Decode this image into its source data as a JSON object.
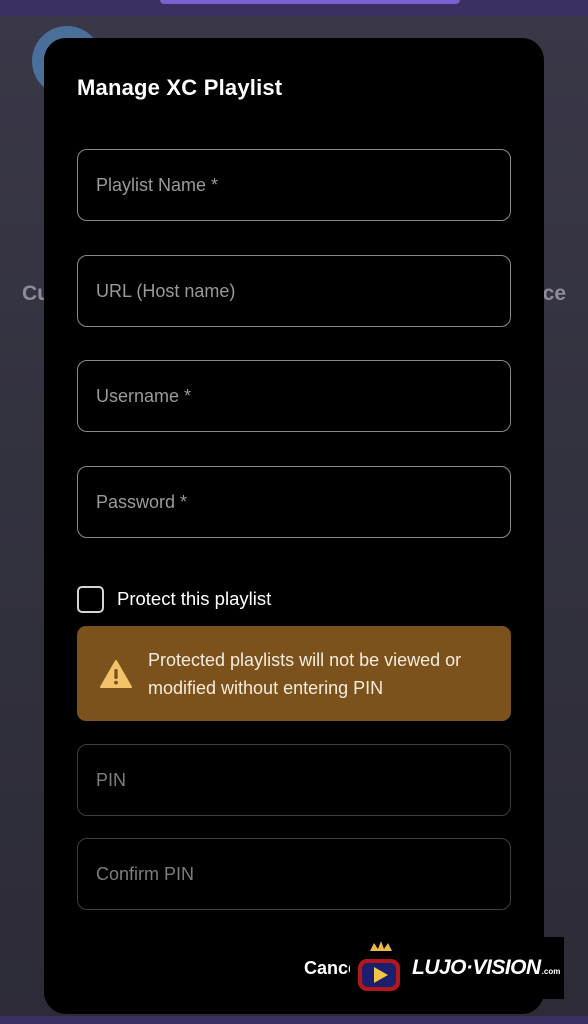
{
  "background": {
    "left_text": "Cu",
    "right_text": "ce"
  },
  "modal": {
    "title": "Manage XC Playlist",
    "fields": {
      "playlist_name": {
        "placeholder": "Playlist Name *",
        "value": ""
      },
      "url": {
        "placeholder": "URL (Host name)",
        "value": ""
      },
      "username": {
        "placeholder": "Username *",
        "value": ""
      },
      "password": {
        "placeholder": "Password *",
        "value": ""
      },
      "pin": {
        "placeholder": "PIN",
        "value": ""
      },
      "confirm_pin": {
        "placeholder": "Confirm PIN",
        "value": ""
      }
    },
    "protect": {
      "label": "Protect this playlist",
      "checked": false
    },
    "warning": {
      "icon": "warning-icon",
      "text": "Protected playlists will not be viewed or modified without entering PIN"
    },
    "cancel_label": "Cancel"
  },
  "watermark": {
    "brand": "LUJO·VISION",
    "suffix": ".com"
  },
  "colors": {
    "modal_bg": "#000000",
    "warning_bg": "#7c521c",
    "warning_icon": "#f2c36b",
    "field_border": "#8a8a8a",
    "background": "#33323f",
    "top_bar": "#3c2f62"
  }
}
